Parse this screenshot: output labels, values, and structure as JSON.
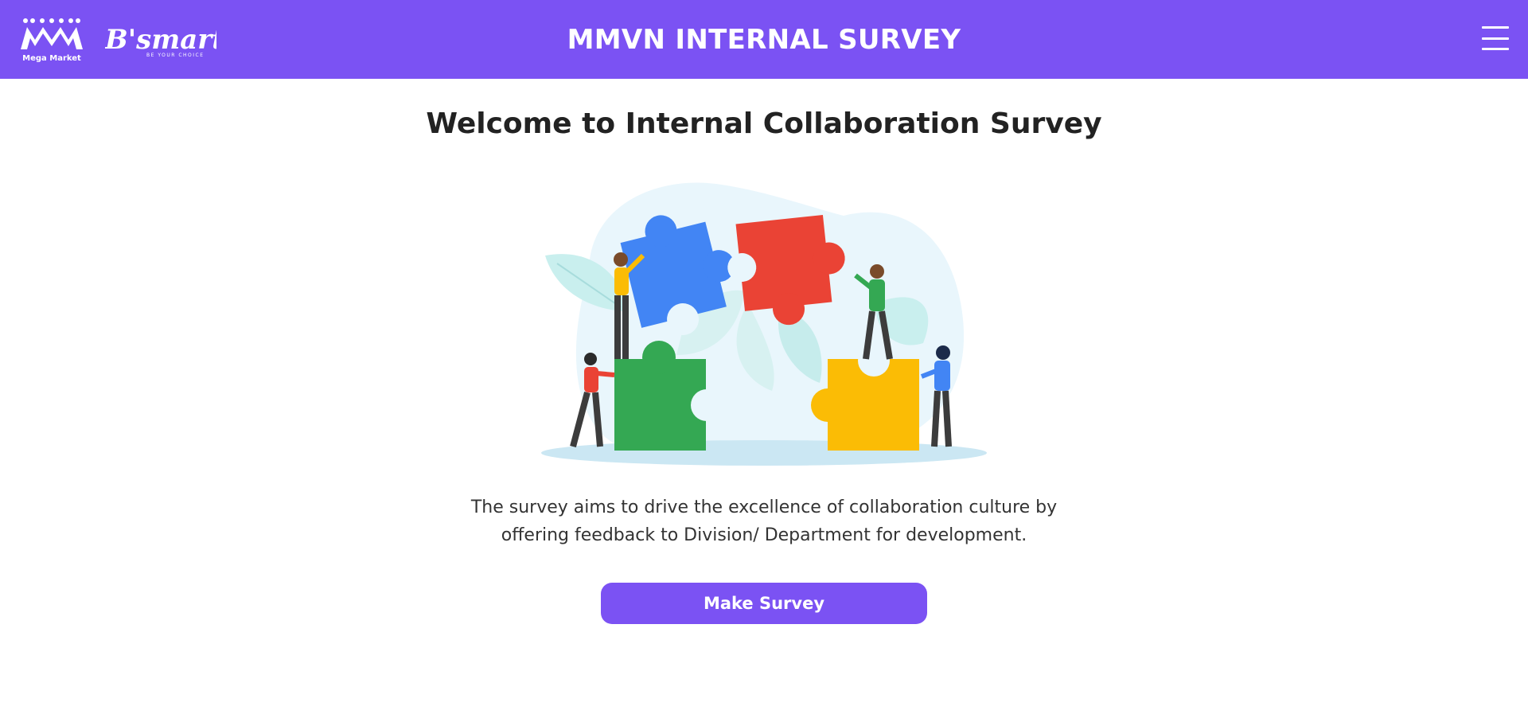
{
  "header": {
    "title": "MMVN INTERNAL SURVEY",
    "logo_primary": "Mega Market",
    "logo_secondary": "B'smart",
    "logo_secondary_tagline": "BE YOUR CHOICE",
    "menu_icon": "hamburger-menu-icon"
  },
  "main": {
    "title": "Welcome to Internal Collaboration Survey",
    "illustration_icon": "puzzle-collaboration-illustration",
    "description": "The survey aims to drive the excellence of collaboration culture by offering feedback to Division/ Department for development.",
    "cta_label": "Make Survey"
  },
  "colors": {
    "brand": "#7b52f3",
    "puzzle_blue": "#4285f4",
    "puzzle_red": "#ea4335",
    "puzzle_green": "#34a853",
    "puzzle_yellow": "#fbbc05"
  }
}
